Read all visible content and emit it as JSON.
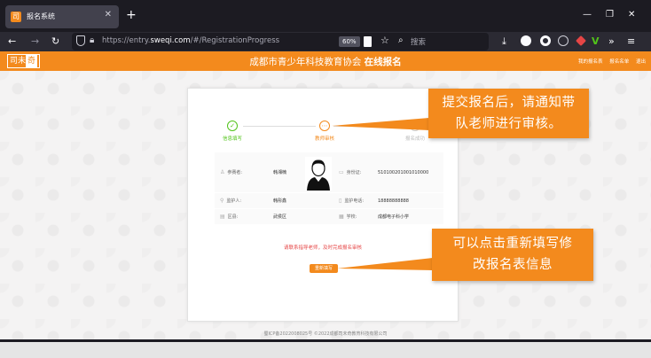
{
  "browser": {
    "tab_title": "报名系统",
    "tab_favicon_text": "司",
    "url_prefix": "https://entry.",
    "url_domain": "sweqi.com",
    "url_suffix": "/#/RegistrationProgress",
    "zoom": "60%",
    "search_placeholder": "搜索"
  },
  "header": {
    "logo_text": "司未",
    "logo_boxed": "奇",
    "title_prefix": "成都市青少年科技教育协会",
    "title_bold": "在线报名",
    "links": [
      "我的报名表",
      "报名名单",
      "退出"
    ]
  },
  "steps": [
    {
      "label": "信息填写",
      "icon": "✓",
      "color": "#52c41a"
    },
    {
      "label": "教师审核",
      "icon": "⋯",
      "color": "#f38a1d"
    },
    {
      "label": "报名成功",
      "icon": "✓",
      "color": "#cccccc"
    }
  ],
  "info": {
    "name_label": "参赛者:",
    "name_value": "韩湘楠",
    "id_label": "身份证:",
    "id_value": "510100201001010000",
    "guardian_label": "监护人:",
    "guardian_value": "韩彤鑫",
    "phone_label": "监护电话:",
    "phone_value": "18888888888",
    "district_label": "区县:",
    "district_value": "武侯区",
    "school_label": "学校:",
    "school_value": "成都电子科小学"
  },
  "notice": "请联系指导老师，及时完成报名审核",
  "refill_button": "重新填写",
  "footer": "蜀ICP备2022008025号 ©2022成都司未奇教育科技有限公司",
  "callouts": {
    "top_line1": "提交报名后，请通知带",
    "top_line2": "队老师进行审核。",
    "bottom_line1": "可以点击重新填写修",
    "bottom_line2": "改报名表信息"
  },
  "colors": {
    "brand_orange": "#f38a1d",
    "success_green": "#52c41a",
    "notice_red": "#e64545"
  }
}
